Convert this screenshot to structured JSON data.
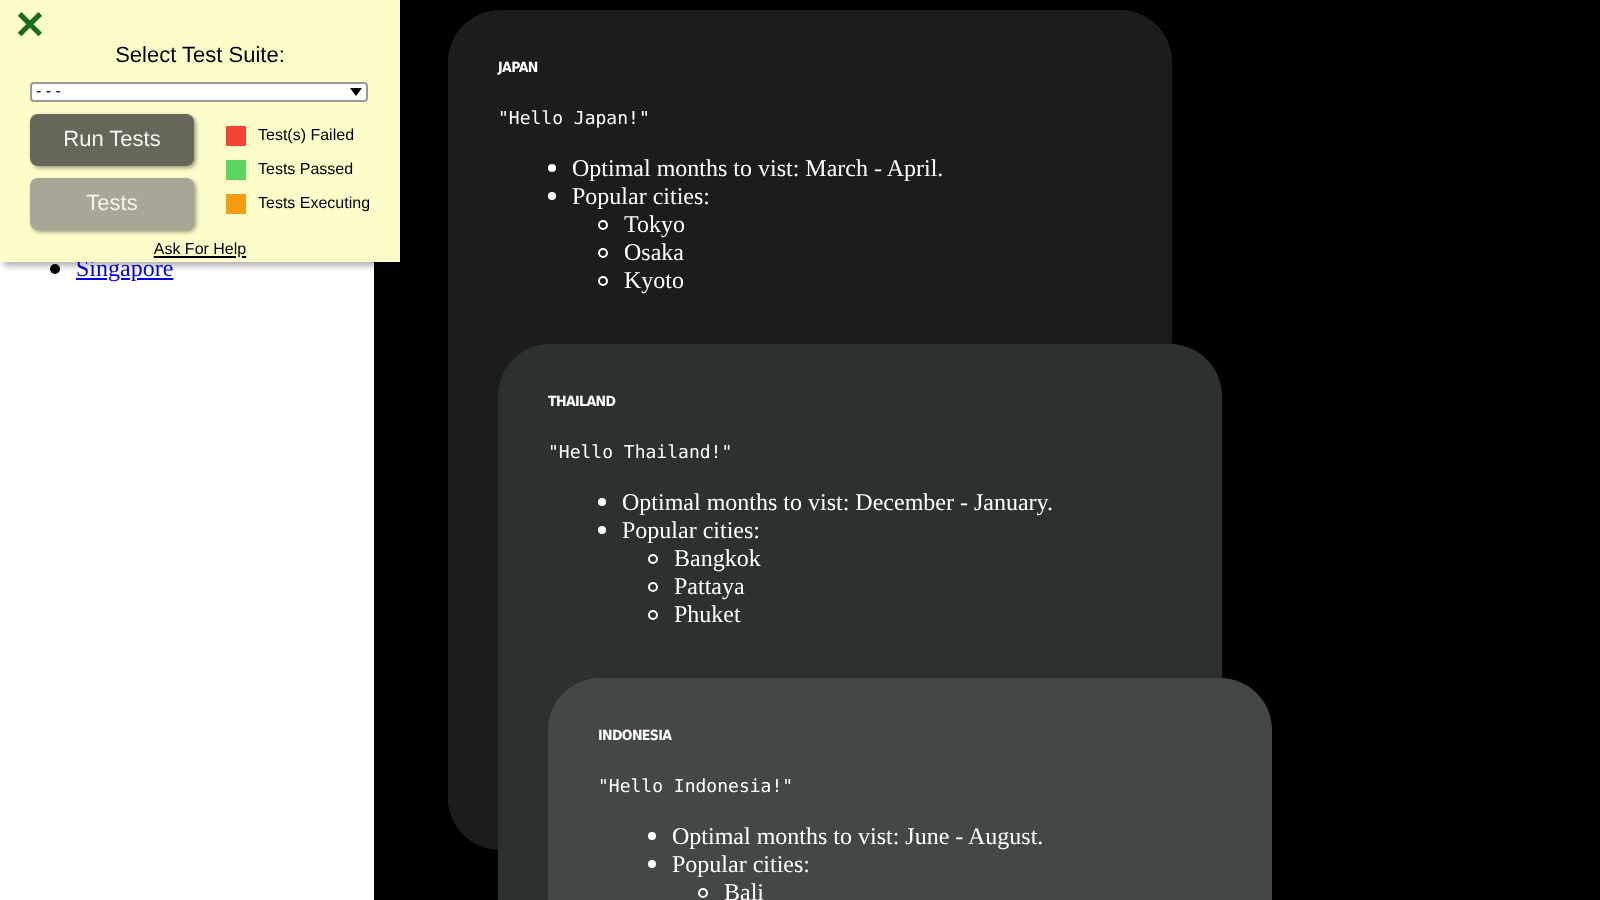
{
  "sidebar": {
    "links": [
      {
        "label": "Singapore"
      }
    ]
  },
  "test_panel": {
    "close": "✕",
    "title": "Select Test Suite:",
    "suite_select": {
      "value": "- - -"
    },
    "buttons": [
      {
        "label": "Run Tests",
        "kind": "primary"
      },
      {
        "label": "Tests",
        "kind": "secondary"
      }
    ],
    "legend": [
      {
        "label": "Test(s) Failed",
        "color": "#f44336"
      },
      {
        "label": "Tests Passed",
        "color": "#5cd65c"
      },
      {
        "label": "Tests Executing",
        "color": "#f39c12"
      }
    ],
    "help_link": "Ask For Help"
  },
  "cards": [
    {
      "title": "JAPAN",
      "greeting": "\"Hello Japan!\"",
      "months": "Optimal months to vist: March - April.",
      "cities_label": "Popular cities:",
      "cities": [
        "Tokyo",
        "Osaka",
        "Kyoto"
      ]
    },
    {
      "title": "THAILAND",
      "greeting": "\"Hello Thailand!\"",
      "months": "Optimal months to vist: December - January.",
      "cities_label": "Popular cities:",
      "cities": [
        "Bangkok",
        "Pattaya",
        "Phuket"
      ]
    },
    {
      "title": "INDONESIA",
      "greeting": "\"Hello Indonesia!\"",
      "months": "Optimal months to vist: June - August.",
      "cities_label": "Popular cities:",
      "cities": [
        "Bali"
      ]
    }
  ]
}
